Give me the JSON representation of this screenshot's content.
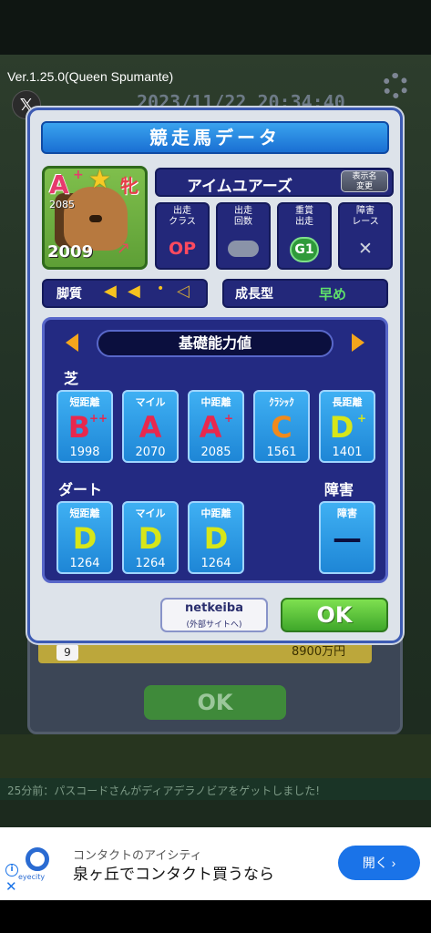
{
  "app": {
    "version": "Ver.1.25.0(Queen Spumante)",
    "bg_date": "2023/11/22 20:34:40"
  },
  "dialog": {
    "title": "競走馬データ",
    "horse": {
      "rank": "A",
      "rank_mod": "+",
      "rating": "2085",
      "gender": "牝",
      "year": "2009",
      "name": "アイムユアーズ",
      "rename_label": "表示名\n変更"
    },
    "stats": [
      {
        "label": "出走\nクラス",
        "value": "OP",
        "color": "#ff4a5f"
      },
      {
        "label": "出走\n回数",
        "value": "",
        "color": "#8a93a8"
      },
      {
        "label": "重賞\n出走",
        "value": "G1",
        "color": "#3fd25a"
      },
      {
        "label": "障害\nレース",
        "value": "✕",
        "color": "#cfd3dd"
      }
    ],
    "legs_label": "脚質",
    "growth_label": "成長型",
    "growth_value": "早め",
    "aptitude_title": "基礎能力値",
    "turf_label": "芝",
    "dirt_label": "ダート",
    "jump_label": "障害",
    "turf": [
      {
        "title": "短距離",
        "grade": "B",
        "mod": "++",
        "value": "1998",
        "color": "#e8284d"
      },
      {
        "title": "マイル",
        "grade": "A",
        "mod": "",
        "value": "2070",
        "color": "#e8284d"
      },
      {
        "title": "中距離",
        "grade": "A",
        "mod": "+",
        "value": "2085",
        "color": "#e8284d"
      },
      {
        "title": "ｸﾗｼｯｸ",
        "grade": "C",
        "mod": "",
        "value": "1561",
        "color": "#f08a1c"
      },
      {
        "title": "長距離",
        "grade": "D",
        "mod": "+",
        "value": "1401",
        "color": "#d7e619"
      }
    ],
    "dirt": [
      {
        "title": "短距離",
        "grade": "D",
        "mod": "",
        "value": "1264",
        "color": "#d7e619"
      },
      {
        "title": "マイル",
        "grade": "D",
        "mod": "",
        "value": "1264",
        "color": "#d7e619"
      },
      {
        "title": "中距離",
        "grade": "D",
        "mod": "",
        "value": "1264",
        "color": "#d7e619"
      }
    ],
    "jump": {
      "title": "障害",
      "grade": "—"
    },
    "netkeiba_label": "netkeiba",
    "netkeiba_sub": "(外部サイトへ)",
    "ok_label": "OK"
  },
  "background": {
    "row_num": "9",
    "row_prize": "8900万円",
    "ok_label": "OK",
    "ticker": "25分前：パスコードさんがディアデラノビアをゲットしました!"
  },
  "ad": {
    "sub": "コンタクトのアイシティ",
    "main": "泉ヶ丘でコンタクト買うなら",
    "button": "開く",
    "brand": "eyecity"
  }
}
